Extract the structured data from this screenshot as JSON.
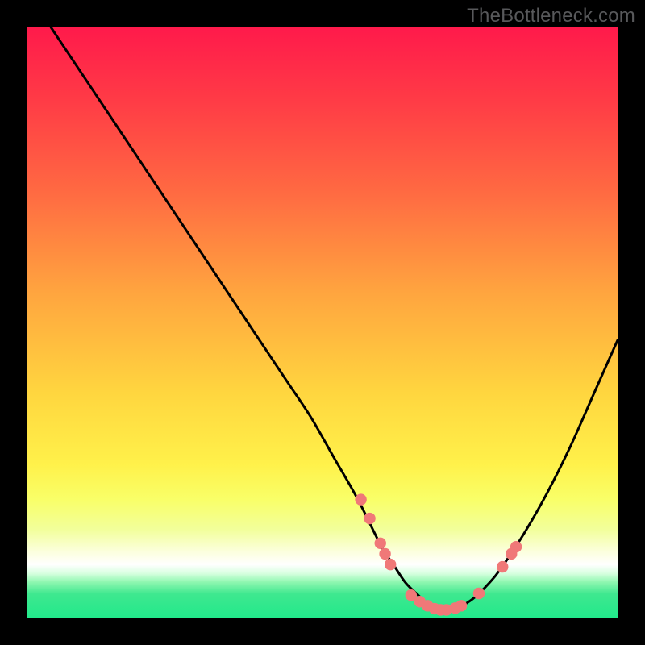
{
  "watermark": "TheBottleneck.com",
  "colors": {
    "bg": "#000000",
    "gradient_top": "#ff1a4b",
    "gradient_mid_red": "#ff4f44",
    "gradient_orange": "#ffa73f",
    "gradient_yellow": "#ffe63f",
    "gradient_pale": "#f7ff6a",
    "gradient_cream": "#fcffd0",
    "gradient_green": "#22e98b",
    "curve": "#000000",
    "dot_fill": "#f07878",
    "dot_stroke": "#c94f4f"
  },
  "chart_data": {
    "type": "line",
    "title": "",
    "xlabel": "",
    "ylabel": "",
    "xlim": [
      0,
      100
    ],
    "ylim": [
      0,
      100
    ],
    "series": [
      {
        "name": "curve",
        "x": [
          4,
          8,
          12,
          16,
          20,
          24,
          28,
          32,
          36,
          40,
          44,
          48,
          52,
          56,
          60,
          62,
          64,
          66,
          68,
          70,
          72,
          74,
          76,
          78,
          80,
          84,
          88,
          92,
          96,
          100
        ],
        "y": [
          100,
          94,
          88,
          82,
          76,
          70,
          64,
          58,
          52,
          46,
          40,
          34,
          27,
          20,
          12,
          9,
          6,
          4,
          2.2,
          1.4,
          1.4,
          2.2,
          3.6,
          5.6,
          8,
          14,
          21,
          29,
          38,
          47
        ]
      }
    ],
    "dots": [
      {
        "x": 56.5,
        "y": 20
      },
      {
        "x": 58.0,
        "y": 16.8
      },
      {
        "x": 59.8,
        "y": 12.6
      },
      {
        "x": 60.6,
        "y": 10.8
      },
      {
        "x": 61.5,
        "y": 9.0
      },
      {
        "x": 65.0,
        "y": 3.8
      },
      {
        "x": 66.5,
        "y": 2.7
      },
      {
        "x": 67.8,
        "y": 2.0
      },
      {
        "x": 69.0,
        "y": 1.5
      },
      {
        "x": 70.0,
        "y": 1.3
      },
      {
        "x": 71.0,
        "y": 1.3
      },
      {
        "x": 72.5,
        "y": 1.6
      },
      {
        "x": 73.5,
        "y": 2.0
      },
      {
        "x": 76.5,
        "y": 4.1
      },
      {
        "x": 80.5,
        "y": 8.6
      },
      {
        "x": 82.0,
        "y": 10.8
      },
      {
        "x": 82.8,
        "y": 12.0
      }
    ]
  }
}
